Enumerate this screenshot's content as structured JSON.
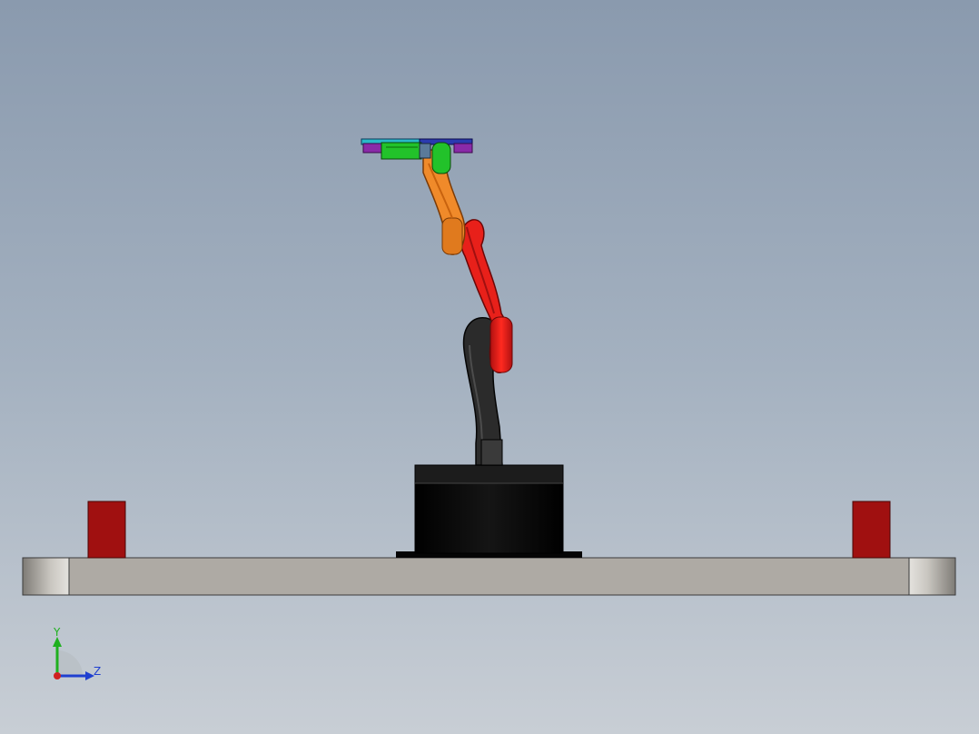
{
  "viewport": {
    "background_top": "#8a9aae",
    "background_bottom": "#c8ced5"
  },
  "model": {
    "parts": [
      "base-plate",
      "left-red-block",
      "right-red-block",
      "robot-base-cylinder",
      "lower-arm-link",
      "upper-arm-link",
      "forearm-link",
      "end-effector-gripper"
    ],
    "colors": {
      "plate": "#aeaaa4",
      "blocks": "#a01010",
      "base": "#0a0a0a",
      "lower_arm": "#2b2b2b",
      "upper_arm": "#e8201a",
      "forearm": "#f08a2a",
      "gripper_green": "#22c22a",
      "gripper_purple": "#8a2aa8",
      "gripper_cyan": "#2ab8c8",
      "gripper_blue": "#2a3ab0"
    }
  },
  "triad": {
    "y_label": "Y",
    "z_label": "Z",
    "y_color": "#1fb01f",
    "z_color": "#1f3fd0",
    "x_color": "#d02020"
  }
}
